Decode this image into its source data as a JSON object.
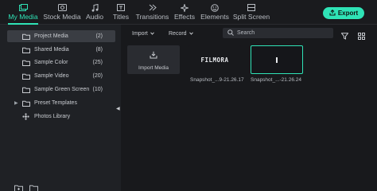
{
  "colors": {
    "accent": "#2fe3b6",
    "sidebar_bg": "#1f2125",
    "app_bg": "#18191c",
    "selected_row": "#3a3d43"
  },
  "tabs": [
    {
      "label": "My Media",
      "icon": "my-media-icon",
      "active": true
    },
    {
      "label": "Stock Media",
      "icon": "stock-media-icon"
    },
    {
      "label": "Audio",
      "icon": "music-note-icon"
    },
    {
      "label": "Titles",
      "icon": "titles-icon"
    },
    {
      "label": "Transitions",
      "icon": "transitions-icon"
    },
    {
      "label": "Effects",
      "icon": "effects-sparkle-icon"
    },
    {
      "label": "Elements",
      "icon": "elements-icon"
    },
    {
      "label": "Split Screen",
      "icon": "split-screen-icon"
    }
  ],
  "export": {
    "label": "Export",
    "icon": "export-icon"
  },
  "sidebar": {
    "items": [
      {
        "label": "Project Media",
        "count": "(2)",
        "icon": "folder-icon",
        "selected": true
      },
      {
        "label": "Shared Media",
        "count": "(8)",
        "icon": "folder-icon"
      },
      {
        "label": "Sample Color",
        "count": "(25)",
        "icon": "folder-icon"
      },
      {
        "label": "Sample Video",
        "count": "(20)",
        "icon": "folder-icon"
      },
      {
        "label": "Sample Green Screen",
        "count": "(10)",
        "icon": "folder-icon"
      },
      {
        "label": "Preset Templates",
        "count": "",
        "icon": "folder-icon",
        "expandable": true
      },
      {
        "label": "Photos Library",
        "count": "",
        "icon": "photos-library-icon"
      }
    ]
  },
  "toolbar": {
    "import_label": "Import",
    "record_label": "Record",
    "search_placeholder": "Search"
  },
  "media": {
    "import_label": "Import Media",
    "items": [
      {
        "thumb_text": "FILMORA",
        "caption": "Snapshot_...9-21.26.17"
      },
      {
        "thumb_text": "",
        "caption": "Snapshot_...-21.26.24",
        "selected": true
      }
    ]
  }
}
